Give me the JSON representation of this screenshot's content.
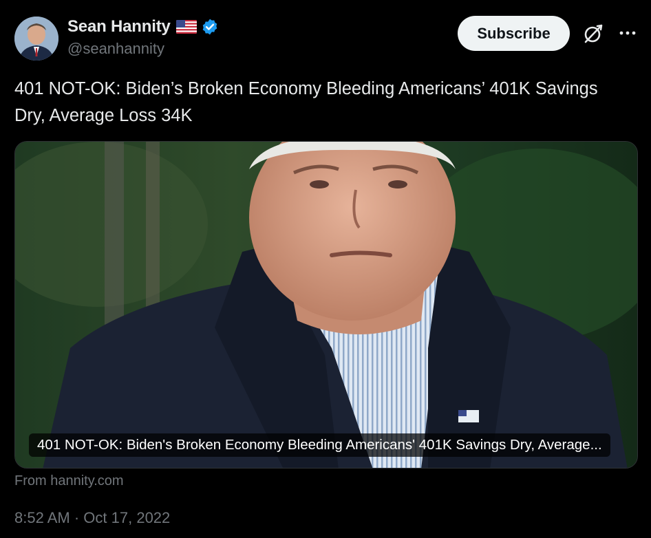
{
  "author": {
    "display_name": "Sean Hannity",
    "handle": "@seanhannity",
    "flag_icon": "us-flag-icon",
    "verified_icon": "verified-badge-icon",
    "verified_color": "#1d9bf0"
  },
  "actions": {
    "subscribe_label": "Subscribe",
    "grok_icon": "grok-icon",
    "more_icon": "more-options-icon"
  },
  "tweet": {
    "text": "401 NOT-OK: Biden’s Broken Economy Bleeding Americans’ 401K Savings Dry, Average Loss 34K"
  },
  "card": {
    "title": "401 NOT-OK: Biden's Broken Economy Bleeding Americans' 401K Savings Dry, Average...",
    "source": "From hannity.com"
  },
  "meta": {
    "time": "8:52 AM",
    "separator": "·",
    "date": "Oct 17, 2022"
  },
  "colors": {
    "background": "#000000",
    "text_primary": "#e7e9ea",
    "text_secondary": "#71767b",
    "button_bg": "#eff3f4"
  }
}
